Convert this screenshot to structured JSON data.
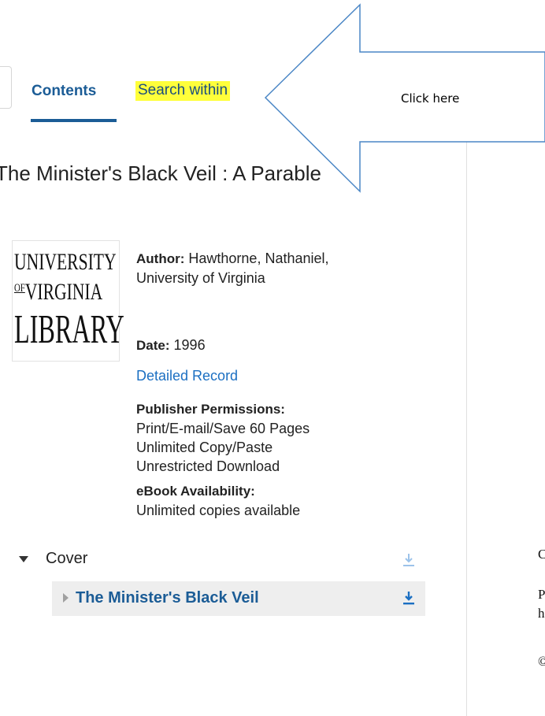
{
  "tabs": [
    {
      "label": "Contents",
      "active": true
    },
    {
      "label": "Search within",
      "highlighted": true
    }
  ],
  "callout": {
    "text": "Click here"
  },
  "book": {
    "title": "The Minister's Black Veil : A Parable",
    "logo": {
      "line1": "UNIVERSITY",
      "of": "OF",
      "line2": "VIRGINIA",
      "line3": "LIBRARY"
    },
    "author_label": "Author:",
    "author_value": "Hawthorne, Nathaniel, University of Virginia",
    "date_label": "Date:",
    "date_value": "1996",
    "detailed_record": "Detailed Record",
    "permissions_label": "Publisher Permissions:",
    "permissions": [
      "Print/E-mail/Save 60 Pages",
      "Unlimited Copy/Paste",
      "Unrestricted Download"
    ],
    "availability_label": "eBook Availability:",
    "availability_value": "Unlimited copies available"
  },
  "toc": {
    "cover_label": "Cover",
    "chapter_label": "The Minister's Black Veil"
  },
  "right_fragments": [
    "C",
    "P",
    "h",
    "©"
  ],
  "colors": {
    "link": "#1b5c96",
    "highlight": "#ffff3a",
    "callout_stroke": "#4a86c5",
    "download_icon": "#1b6fc2"
  },
  "icons": {
    "download": "download-icon",
    "expand": "triangle-down-icon",
    "collapse": "triangle-right-icon"
  }
}
